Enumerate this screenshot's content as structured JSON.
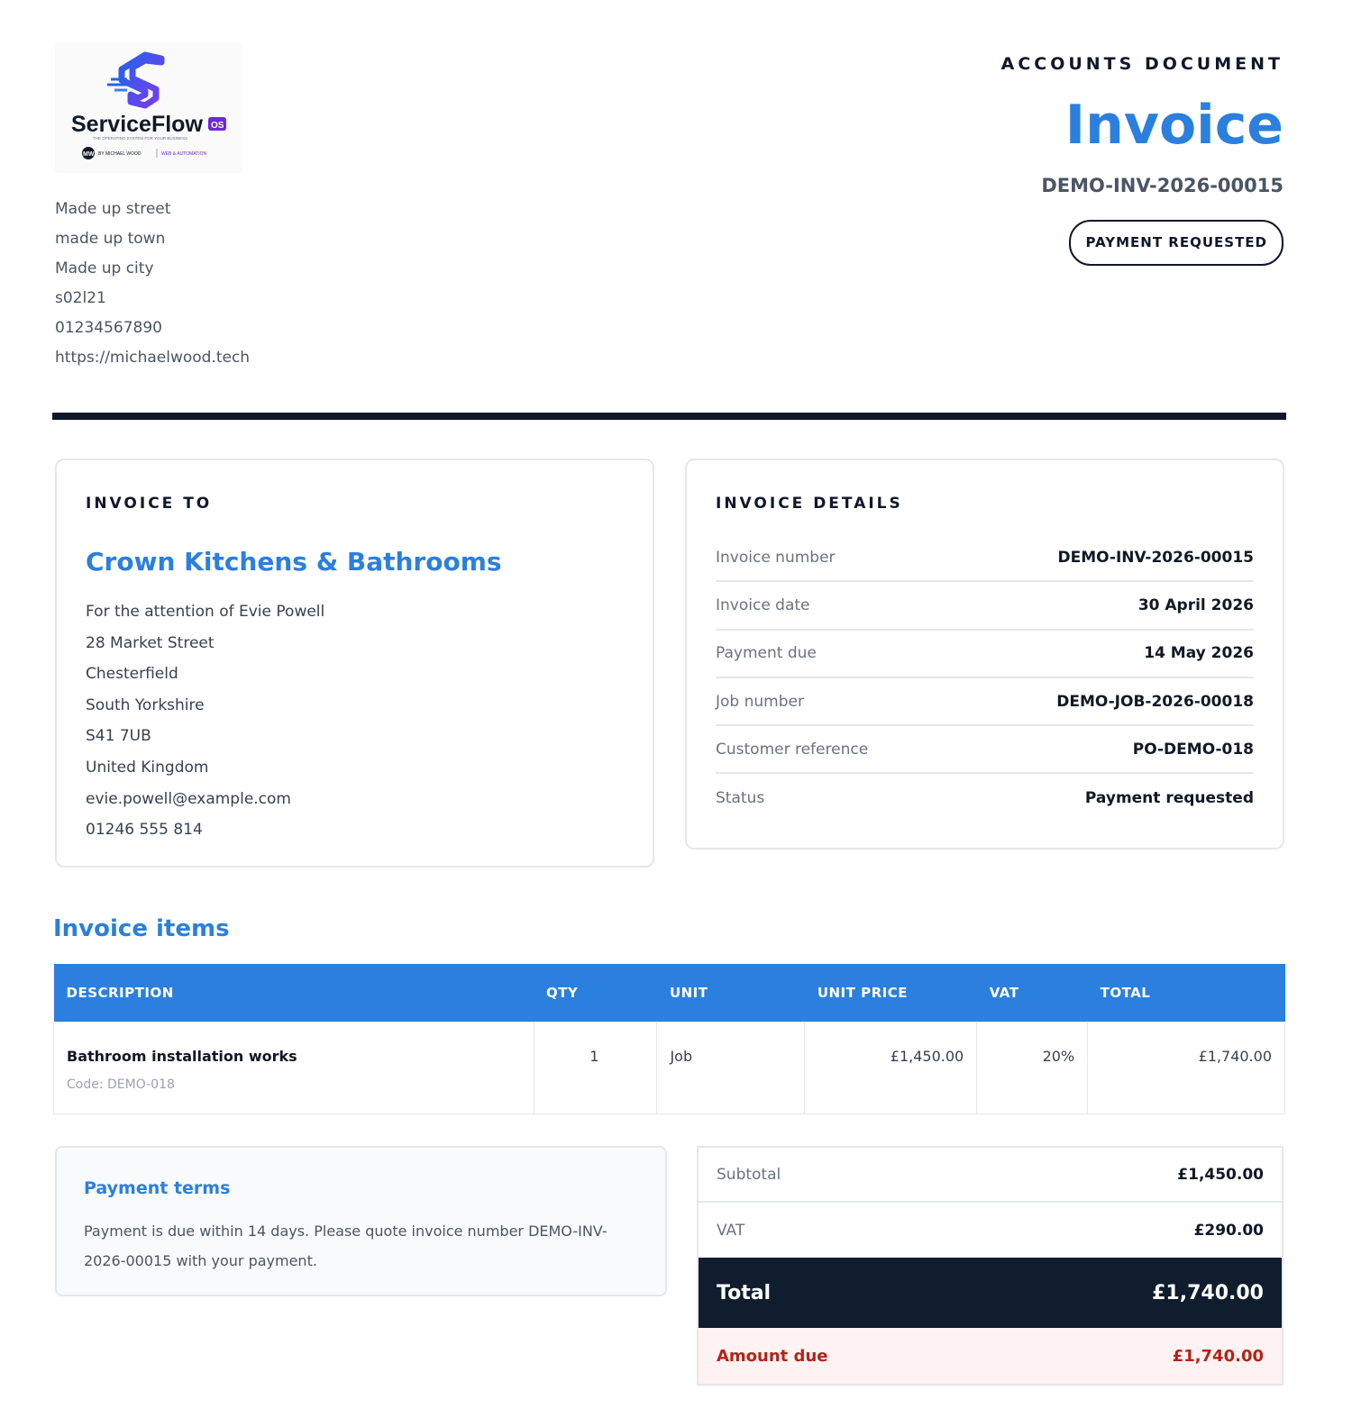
{
  "company": {
    "logo_name": "ServiceFlow",
    "logo_badge": "OS",
    "logo_tagline": "THE OPERATING SYSTEM FOR YOUR BUSINESS",
    "logo_byline": "BY MICHAEL WOOD",
    "logo_byline_right": "WEB & AUTOMATION",
    "address_lines": [
      "Made up street",
      "made up town",
      "Made up city",
      "s02l21",
      "01234567890",
      "https://michaelwood.tech"
    ]
  },
  "header": {
    "kind": "ACCOUNTS DOCUMENT",
    "title": "Invoice",
    "number": "DEMO-INV-2026-00015",
    "status": "PAYMENT REQUESTED"
  },
  "invoice_to": {
    "heading": "INVOICE TO",
    "name": "Crown Kitchens & Bathrooms",
    "lines": [
      "For the attention of Evie Powell",
      "28 Market Street",
      "Chesterfield",
      "South Yorkshire",
      "S41 7UB",
      "United Kingdom",
      "evie.powell@example.com",
      "01246 555 814"
    ]
  },
  "details": {
    "heading": "INVOICE DETAILS",
    "rows": [
      {
        "label": "Invoice number",
        "value": "DEMO-INV-2026-00015"
      },
      {
        "label": "Invoice date",
        "value": "30 April 2026"
      },
      {
        "label": "Payment due",
        "value": "14 May 2026"
      },
      {
        "label": "Job number",
        "value": "DEMO-JOB-2026-00018"
      },
      {
        "label": "Customer reference",
        "value": "PO-DEMO-018"
      },
      {
        "label": "Status",
        "value": "Payment requested"
      }
    ]
  },
  "items": {
    "heading": "Invoice items",
    "columns": [
      "DESCRIPTION",
      "QTY",
      "UNIT",
      "UNIT PRICE",
      "VAT",
      "TOTAL"
    ],
    "rows": [
      {
        "description": "Bathroom installation works",
        "code": "Code: DEMO-018",
        "qty": "1",
        "unit": "Job",
        "unit_price": "£1,450.00",
        "vat": "20%",
        "total": "£1,740.00"
      }
    ]
  },
  "terms": {
    "title": "Payment terms",
    "text": "Payment is due within 14 days. Please quote invoice number DEMO-INV-2026-00015 with your payment."
  },
  "totals": {
    "subtotal_label": "Subtotal",
    "subtotal": "£1,450.00",
    "vat_label": "VAT",
    "vat": "£290.00",
    "total_label": "Total",
    "total": "£1,740.00",
    "due_label": "Amount due",
    "due": "£1,740.00"
  },
  "colors": {
    "accent": "#2b7fde",
    "dark": "#0f172a",
    "due": "#b42318"
  }
}
